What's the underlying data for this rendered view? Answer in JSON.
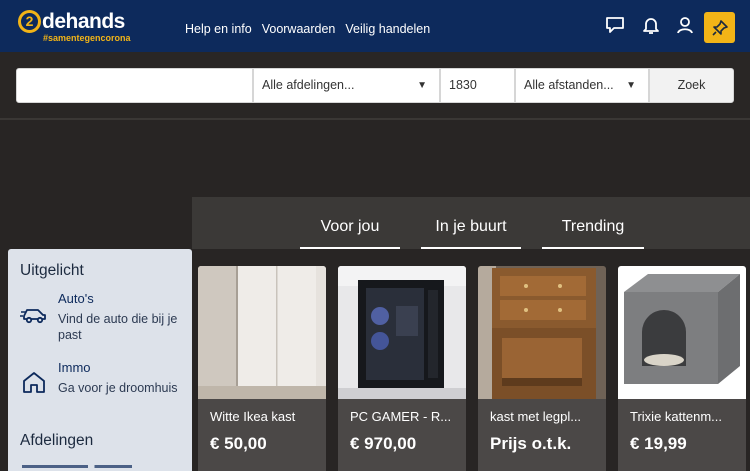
{
  "header": {
    "logo_mark": "2",
    "logo_text": "dehands",
    "logo_tagline": "#samentegencorona",
    "nav": [
      "Help en info",
      "Voorwaarden",
      "Veilig handelen"
    ],
    "icons": [
      "chat-icon",
      "bell-icon",
      "user-icon",
      "pin-icon"
    ],
    "accent": "#f2b417",
    "bg": "#0d2a5c"
  },
  "search": {
    "query_value": "",
    "category": "Alle afdelingen...",
    "zip": "1830",
    "distance": "Alle afstanden...",
    "submit": "Zoek"
  },
  "tabs": [
    {
      "label": "Voor jou",
      "active": true
    },
    {
      "label": "In je buurt",
      "active": false
    },
    {
      "label": "Trending",
      "active": false
    }
  ],
  "sidebar": {
    "heading_featured": "Uitgelicht",
    "items": [
      {
        "title": "Auto's",
        "desc": "Vind de auto die bij je past",
        "icon": "car-icon"
      },
      {
        "title": "Immo",
        "desc": "Ga voor je droomhuis",
        "icon": "house-icon"
      }
    ],
    "heading_departments": "Afdelingen"
  },
  "listings": [
    {
      "title": "Witte Ikea kast",
      "price": "€ 50,00"
    },
    {
      "title": "PC GAMER - R...",
      "price": "€ 970,00"
    },
    {
      "title": "kast met legpl...",
      "price": "Prijs o.t.k."
    },
    {
      "title": "Trixie kattenm...",
      "price": "€ 19,99"
    }
  ]
}
